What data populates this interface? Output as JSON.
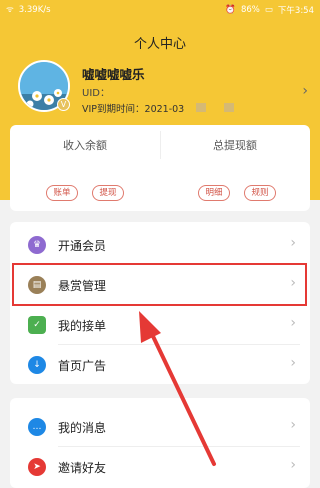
{
  "status_bar": {
    "signal": "ᯤ",
    "speed": "3.39K/s",
    "battery": "86%",
    "time": "下午3:54"
  },
  "header": {
    "title": "个人中心"
  },
  "profile": {
    "name": "嘘嘘嘘嘘乐",
    "uid_label": "UID：",
    "vip_label": "VIP到期时间：",
    "vip_date": "2021-03"
  },
  "stats": {
    "income": "收入余额",
    "withdraw_total": "总提现额",
    "left_buttons": [
      "账单",
      "提现"
    ],
    "right_buttons": [
      "明细",
      "规则"
    ]
  },
  "menu1": [
    {
      "label": "开通会员",
      "icon": "crown-icon"
    },
    {
      "label": "悬赏管理",
      "icon": "wallet-icon"
    },
    {
      "label": "我的接单",
      "icon": "clipboard-check-icon"
    },
    {
      "label": "首页广告",
      "icon": "download-icon"
    }
  ],
  "menu2": [
    {
      "label": "我的消息",
      "icon": "message-icon"
    },
    {
      "label": "邀请好友",
      "icon": "send-icon"
    }
  ],
  "colors": {
    "accent": "#f5c735",
    "highlight": "#e53935"
  }
}
